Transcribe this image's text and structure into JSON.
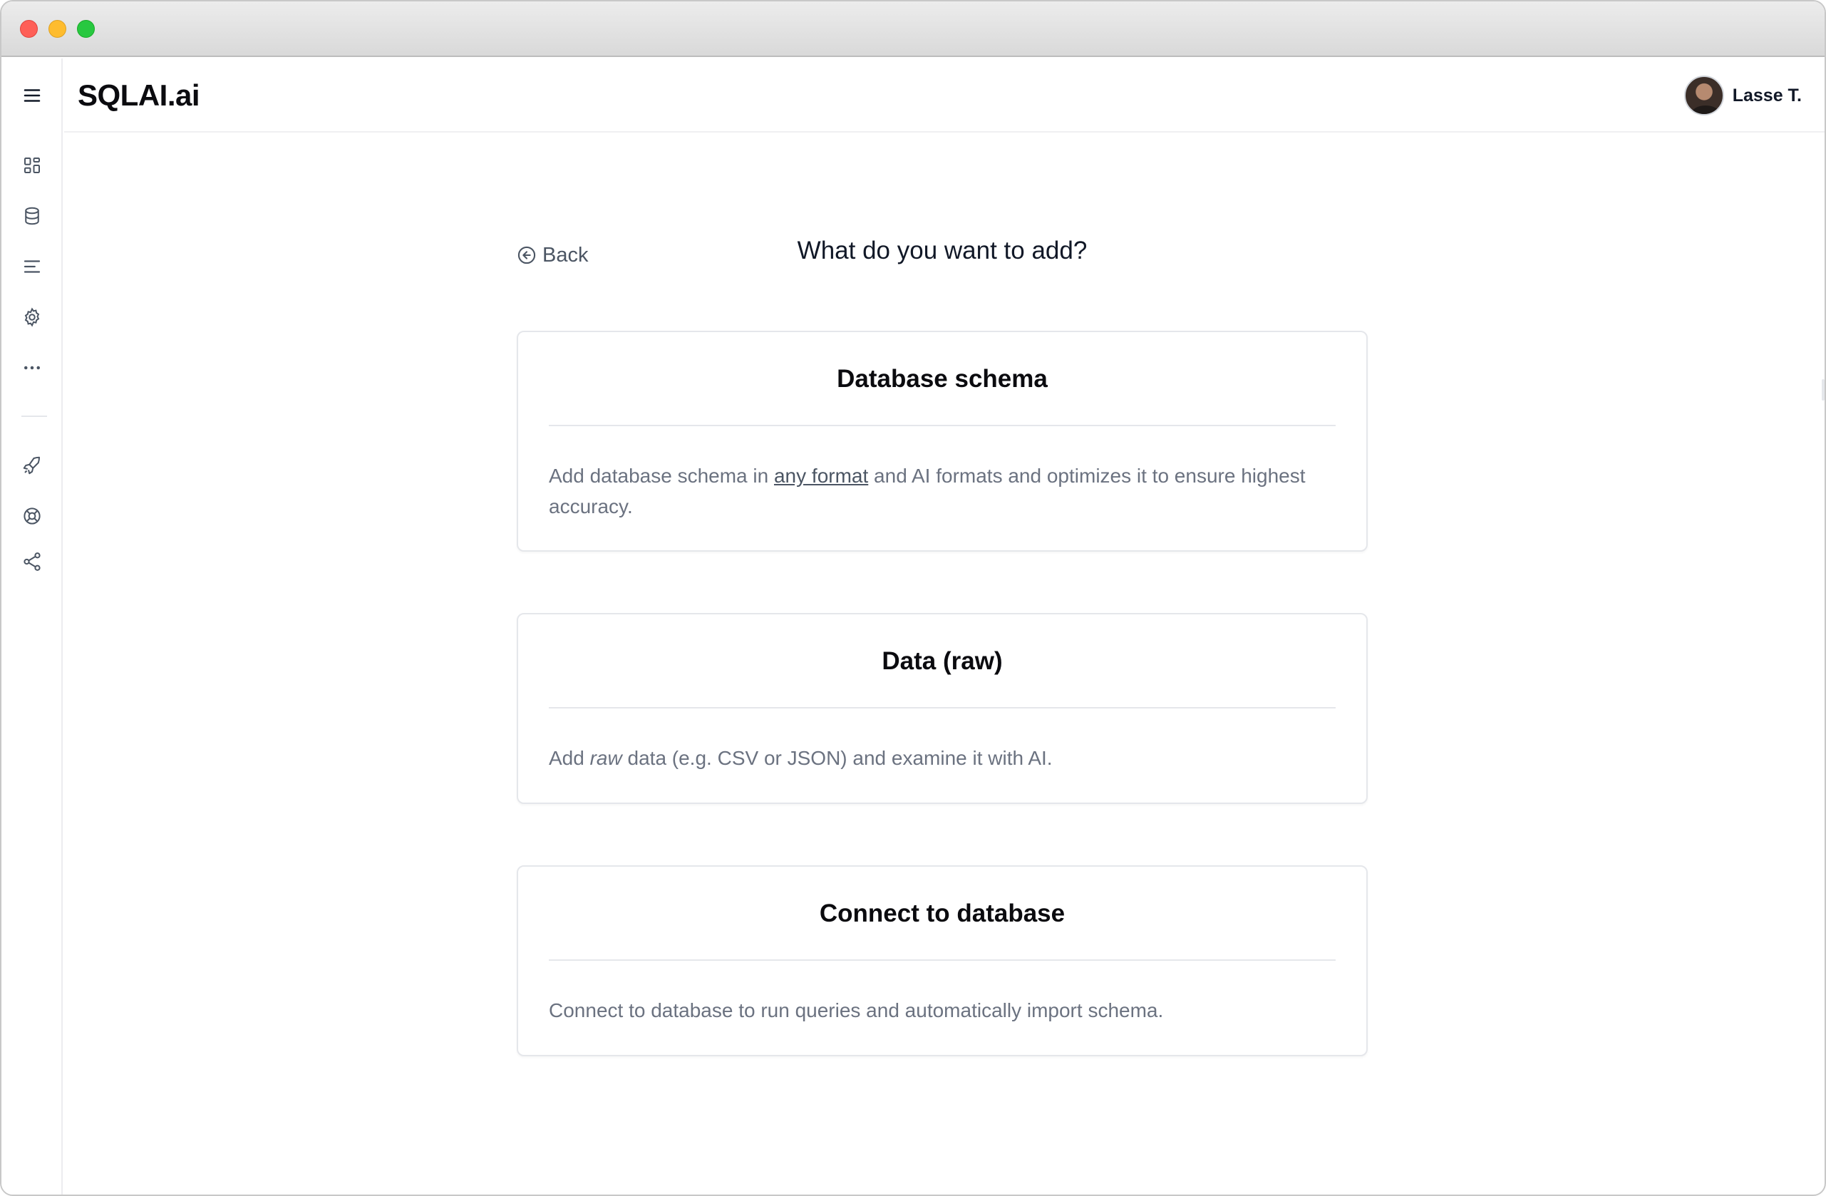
{
  "app": {
    "logo": "SQLAI.ai",
    "user_name": "Lasse T."
  },
  "sidebar": {
    "icons": [
      "menu-icon",
      "dashboard-icon",
      "database-icon",
      "list-icon",
      "gear-icon",
      "more-icon",
      "rocket-icon",
      "lifebuoy-icon",
      "share-icon"
    ]
  },
  "page": {
    "back_label": "Back",
    "title": "What do you want to add?"
  },
  "cards": [
    {
      "title": "Database schema",
      "text_before": "Add database schema in ",
      "link": "any format",
      "text_after": " and AI formats and optimizes it to ensure highest accuracy."
    },
    {
      "title": "Data (raw)",
      "text_before": "Add ",
      "emphasis": "raw",
      "text_after": " data (e.g. CSV or JSON) and examine it with AI."
    },
    {
      "title": "Connect to database",
      "text": "Connect to database to run queries and automatically import schema."
    }
  ]
}
